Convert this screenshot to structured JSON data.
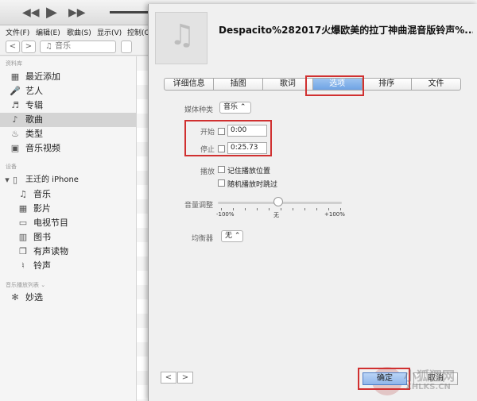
{
  "menubar": {
    "items": [
      "文件(F)",
      "编辑(E)",
      "歌曲(S)",
      "显示(V)",
      "控制(C)"
    ]
  },
  "navbar": {
    "back": "<",
    "forward": ">",
    "media_kind": "音乐"
  },
  "sidebar": {
    "library_header": "资料库",
    "library": [
      {
        "label": "最近添加",
        "icon": "grid-icon",
        "glyph": "▦"
      },
      {
        "label": "艺人",
        "icon": "mic-icon",
        "glyph": "🎤"
      },
      {
        "label": "专辑",
        "icon": "album-icon",
        "glyph": "♬"
      },
      {
        "label": "歌曲",
        "icon": "note-icon",
        "glyph": "♪"
      },
      {
        "label": "类型",
        "icon": "genre-icon",
        "glyph": "♨"
      },
      {
        "label": "音乐视频",
        "icon": "video-icon",
        "glyph": "▣"
      }
    ],
    "devices_header": "设备",
    "device_name": "王迁的 iPhone",
    "device_items": [
      {
        "label": "音乐",
        "icon": "note-icon",
        "glyph": "♫"
      },
      {
        "label": "影片",
        "icon": "film-icon",
        "glyph": "▦"
      },
      {
        "label": "电视节目",
        "icon": "tv-icon",
        "glyph": "▭"
      },
      {
        "label": "图书",
        "icon": "book-icon",
        "glyph": "▥"
      },
      {
        "label": "有声读物",
        "icon": "audiobook-icon",
        "glyph": "❒"
      },
      {
        "label": "铃声",
        "icon": "bell-icon",
        "glyph": "♮"
      }
    ],
    "playlists_header": "音乐播放列表 ⌄",
    "genius": "妙选"
  },
  "dialog": {
    "title": "Despacito%282017火爆欧美的拉丁神曲混音版铃声%...",
    "tabs": [
      "详细信息",
      "插图",
      "歌词",
      "选项",
      "排序",
      "文件"
    ],
    "active_tab": 3,
    "media_kind_label": "媒体种类",
    "media_kind_value": "音乐 ⌃",
    "start_label": "开始",
    "start_value": "0:00",
    "stop_label": "停止",
    "stop_value": "0:25.73",
    "playback_label": "播放",
    "remember_position": "记住播放位置",
    "skip_shuffle": "随机播放时跳过",
    "volume_label": "音量调整",
    "volume_min": "-100%",
    "volume_mid": "无",
    "volume_max": "+100%",
    "volume_adjust_percent": 0,
    "equalizer_label": "均衡器",
    "equalizer_value": "无 ⌃",
    "ok": "确定",
    "cancel": "取消",
    "prev": "<",
    "next": ">"
  },
  "watermark": {
    "text": "小狐狸网",
    "sub": "XHLKS.CN"
  }
}
